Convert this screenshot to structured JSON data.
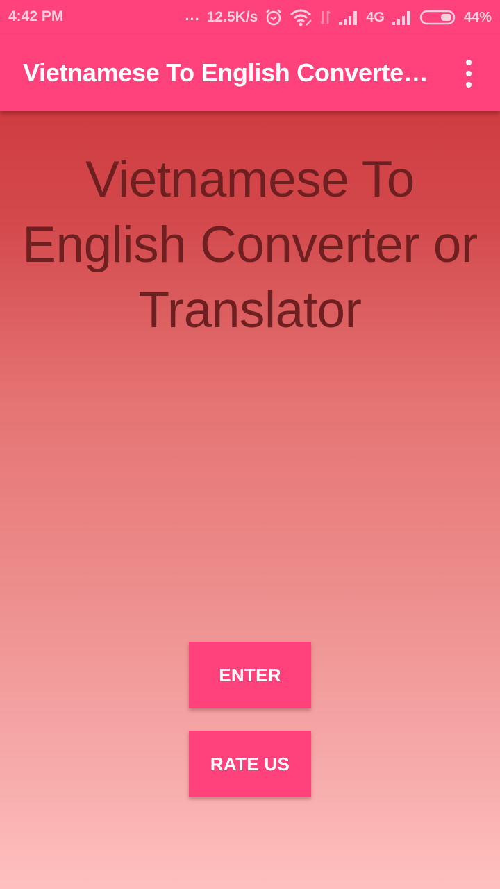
{
  "status_bar": {
    "time": "4:42 PM",
    "dots": "...",
    "network_speed": "12.5K/s",
    "icons": [
      "alarm-icon",
      "wifi-icon",
      "data-transfer-icon",
      "signal-icon",
      "signal-icon-2",
      "battery-icon"
    ],
    "network_type": "4G",
    "battery_percent": "44%",
    "battery_level": 0.44
  },
  "app_bar": {
    "title": "Vietnamese To English Converter or Translator",
    "menu_icon": "more-vert-icon"
  },
  "main": {
    "heading": "Vietnamese To English Converter or Translator",
    "buttons": {
      "enter": "ENTER",
      "rate_us": "RATE US"
    }
  },
  "colors": {
    "primary": "#ff417c",
    "heading_text": "#6e2020",
    "gradient_top": "#cc3135",
    "gradient_bottom": "#fec0bf"
  }
}
